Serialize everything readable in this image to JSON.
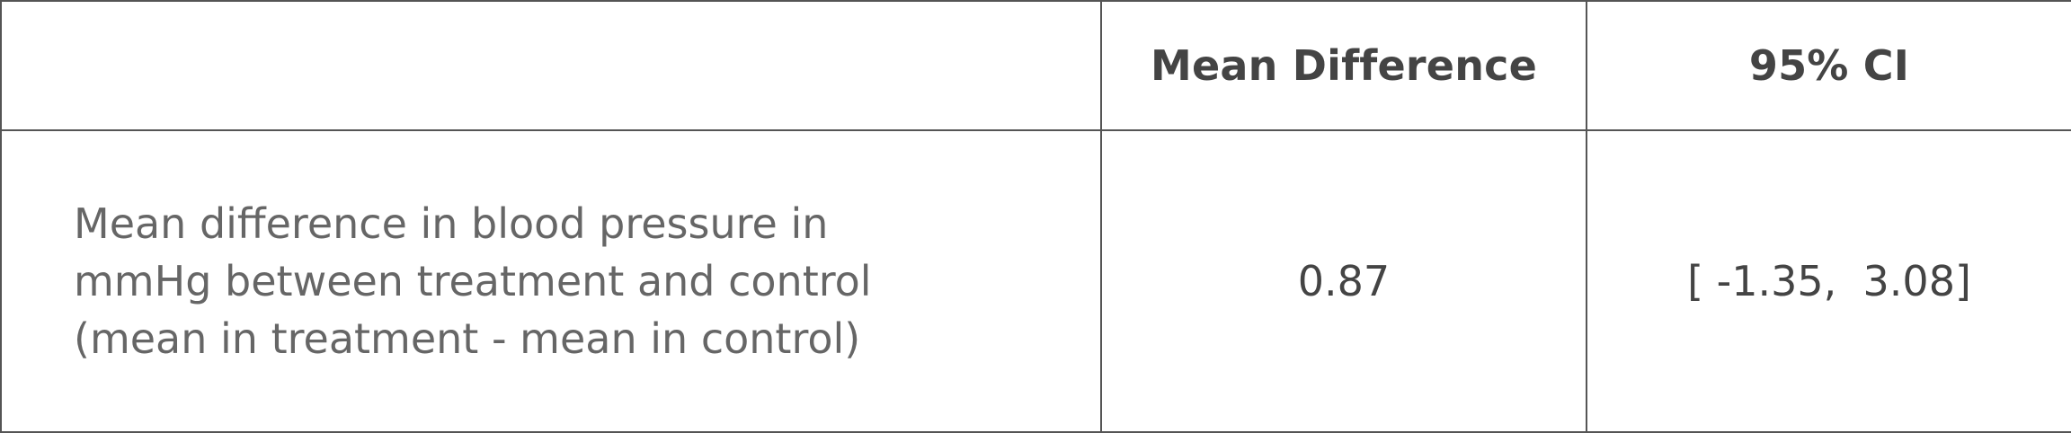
{
  "table": {
    "header": {
      "corner": "",
      "mean_difference": "Mean Difference",
      "ci": "95% CI"
    },
    "row": {
      "label_lines": [
        "Mean difference in blood pressure in",
        "mmHg between treatment and control",
        "(mean in treatment - mean in control)"
      ],
      "mean_difference": "0.87",
      "ci": "[ -1.35,  3.08]"
    }
  },
  "colors": {
    "border": "#555555",
    "header_text": "#444444",
    "label_text": "#666666",
    "background": "#ffffff"
  }
}
